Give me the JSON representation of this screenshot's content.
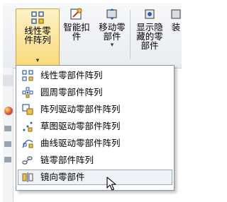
{
  "ribbon": {
    "buttons": [
      {
        "label_line1": "线性零",
        "label_line2": "件阵列",
        "icon": "linear-pattern-icon"
      },
      {
        "label_line1": "智能扣",
        "label_line2": "件",
        "icon": "smart-fastener-icon"
      },
      {
        "label_line1": "移动零",
        "label_line2": "部件",
        "icon": "move-component-icon"
      },
      {
        "label_line1": "显示隐",
        "label_line2": "藏的零",
        "label_line3": "部件",
        "icon": "show-hidden-icon"
      },
      {
        "label_line1": "装",
        "icon": "assembly-icon"
      }
    ],
    "dropdown_arrow": "▾"
  },
  "menu": {
    "items": [
      {
        "label": "线性零部件阵列",
        "icon": "linear-pattern-icon"
      },
      {
        "label": "圆周零部件阵列",
        "icon": "circular-pattern-icon"
      },
      {
        "label": "阵列驱动零部件阵列",
        "icon": "pattern-driven-icon"
      },
      {
        "label": "草图驱动零部件阵列",
        "icon": "sketch-driven-icon"
      },
      {
        "label": "曲线驱动零部件阵列",
        "icon": "curve-driven-icon"
      },
      {
        "label": "链零部件阵列",
        "icon": "chain-pattern-icon"
      },
      {
        "label": "镜向零部件",
        "icon": "mirror-component-icon"
      }
    ]
  },
  "colors": {
    "active_button": "#f9d977",
    "menu_border": "#8a949f",
    "hover_fill": "#eef1f5"
  }
}
